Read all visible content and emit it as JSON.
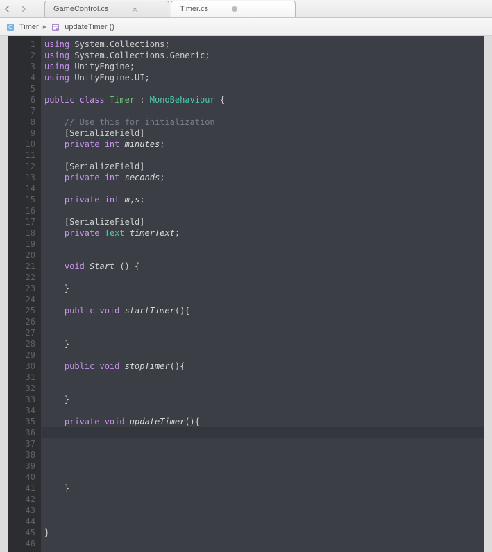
{
  "nav": {
    "tabs": [
      {
        "label": "GameControl.cs",
        "active": false
      },
      {
        "label": "Timer.cs",
        "active": true
      }
    ]
  },
  "breadcrumb": {
    "class": "Timer",
    "method": "updateTimer ()"
  },
  "code": {
    "lines": [
      {
        "n": 1,
        "t": [
          [
            "kw",
            "using"
          ],
          [
            "pl",
            " System.Collections;"
          ]
        ]
      },
      {
        "n": 2,
        "t": [
          [
            "kw",
            "using"
          ],
          [
            "pl",
            " System.Collections.Generic;"
          ]
        ]
      },
      {
        "n": 3,
        "t": [
          [
            "kw",
            "using"
          ],
          [
            "pl",
            " UnityEngine;"
          ]
        ]
      },
      {
        "n": 4,
        "t": [
          [
            "kw",
            "using"
          ],
          [
            "pl",
            " UnityEngine.UI;"
          ]
        ]
      },
      {
        "n": 5,
        "t": []
      },
      {
        "n": 6,
        "t": [
          [
            "kw",
            "public class "
          ],
          [
            "cname",
            "Timer"
          ],
          [
            "pl",
            " : "
          ],
          [
            "type",
            "MonoBehaviour"
          ],
          [
            "pl",
            " {"
          ]
        ]
      },
      {
        "n": 7,
        "t": []
      },
      {
        "n": 8,
        "t": [
          [
            "pl",
            "    "
          ],
          [
            "comment",
            "// Use this for initialization"
          ]
        ]
      },
      {
        "n": 9,
        "t": [
          [
            "pl",
            "    [SerializeField]"
          ]
        ]
      },
      {
        "n": 10,
        "t": [
          [
            "pl",
            "    "
          ],
          [
            "kw",
            "private int "
          ],
          [
            "mname",
            "minutes"
          ],
          [
            "pl",
            ";"
          ]
        ]
      },
      {
        "n": 11,
        "t": []
      },
      {
        "n": 12,
        "t": [
          [
            "pl",
            "    [SerializeField]"
          ]
        ]
      },
      {
        "n": 13,
        "t": [
          [
            "pl",
            "    "
          ],
          [
            "kw",
            "private int "
          ],
          [
            "mname",
            "seconds"
          ],
          [
            "pl",
            ";"
          ]
        ]
      },
      {
        "n": 14,
        "t": []
      },
      {
        "n": 15,
        "t": [
          [
            "pl",
            "    "
          ],
          [
            "kw",
            "private int "
          ],
          [
            "mname",
            "m"
          ],
          [
            "pl",
            ","
          ],
          [
            "mname",
            "s"
          ],
          [
            "pl",
            ";"
          ]
        ]
      },
      {
        "n": 16,
        "t": []
      },
      {
        "n": 17,
        "t": [
          [
            "pl",
            "    [SerializeField]"
          ]
        ]
      },
      {
        "n": 18,
        "t": [
          [
            "pl",
            "    "
          ],
          [
            "kw",
            "private "
          ],
          [
            "type",
            "Text "
          ],
          [
            "mname",
            "timerText"
          ],
          [
            "pl",
            ";"
          ]
        ]
      },
      {
        "n": 19,
        "t": []
      },
      {
        "n": 20,
        "t": []
      },
      {
        "n": 21,
        "t": [
          [
            "pl",
            "    "
          ],
          [
            "kw",
            "void "
          ],
          [
            "mname",
            "Start"
          ],
          [
            "pl",
            " () {"
          ]
        ]
      },
      {
        "n": 22,
        "t": []
      },
      {
        "n": 23,
        "t": [
          [
            "pl",
            "    }"
          ]
        ]
      },
      {
        "n": 24,
        "t": []
      },
      {
        "n": 25,
        "t": [
          [
            "pl",
            "    "
          ],
          [
            "kw",
            "public void "
          ],
          [
            "mname",
            "startTimer"
          ],
          [
            "pl",
            "(){"
          ]
        ]
      },
      {
        "n": 26,
        "t": []
      },
      {
        "n": 27,
        "t": []
      },
      {
        "n": 28,
        "t": [
          [
            "pl",
            "    }"
          ]
        ]
      },
      {
        "n": 29,
        "t": []
      },
      {
        "n": 30,
        "t": [
          [
            "pl",
            "    "
          ],
          [
            "kw",
            "public void "
          ],
          [
            "mname",
            "stopTimer"
          ],
          [
            "pl",
            "(){"
          ]
        ]
      },
      {
        "n": 31,
        "t": []
      },
      {
        "n": 32,
        "t": []
      },
      {
        "n": 33,
        "t": [
          [
            "pl",
            "    }"
          ]
        ]
      },
      {
        "n": 34,
        "t": []
      },
      {
        "n": 35,
        "t": [
          [
            "pl",
            "    "
          ],
          [
            "kw",
            "private void "
          ],
          [
            "mname",
            "updateTimer"
          ],
          [
            "pl",
            "(){"
          ]
        ]
      },
      {
        "n": 36,
        "t": [
          [
            "pl",
            "        "
          ],
          [
            "cursor",
            ""
          ]
        ],
        "active": true
      },
      {
        "n": 37,
        "t": []
      },
      {
        "n": 38,
        "t": []
      },
      {
        "n": 39,
        "t": []
      },
      {
        "n": 40,
        "t": []
      },
      {
        "n": 41,
        "t": [
          [
            "pl",
            "    }"
          ]
        ]
      },
      {
        "n": 42,
        "t": []
      },
      {
        "n": 43,
        "t": []
      },
      {
        "n": 44,
        "t": []
      },
      {
        "n": 45,
        "t": [
          [
            "pl",
            "}"
          ]
        ]
      },
      {
        "n": 46,
        "t": []
      }
    ]
  }
}
